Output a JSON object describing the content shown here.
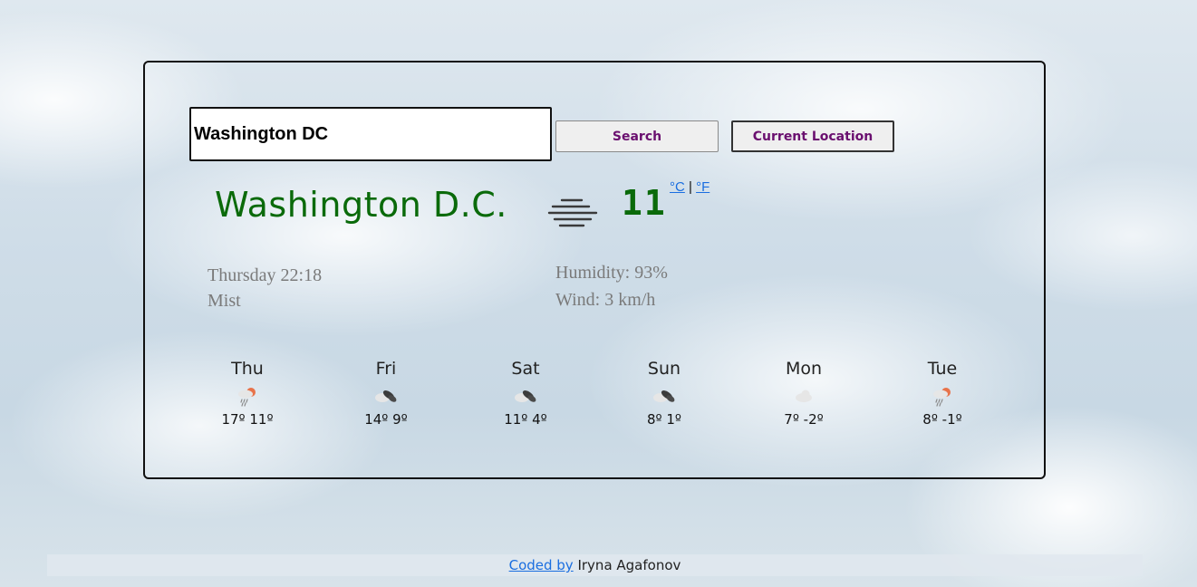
{
  "search": {
    "value": "Washington DC",
    "search_label": "Search",
    "location_label": "Current Location"
  },
  "current": {
    "city": "Washington D.C.",
    "temperature": "11",
    "unit_celsius": "°C",
    "unit_separator": "|",
    "unit_fahrenheit": "°F",
    "date_time": "Thursday 22:18",
    "description": "Mist",
    "humidity": "Humidity: 93%",
    "wind": "Wind: 3 km/h",
    "icon": "mist-icon"
  },
  "forecast": [
    {
      "day": "Thu",
      "temps": "17º 11º",
      "icon": "rain-sun-cloud-icon"
    },
    {
      "day": "Fri",
      "temps": "14º 9º",
      "icon": "broken-clouds-icon"
    },
    {
      "day": "Sat",
      "temps": "11º 4º",
      "icon": "broken-clouds-icon"
    },
    {
      "day": "Sun",
      "temps": "8º 1º",
      "icon": "broken-clouds-icon"
    },
    {
      "day": "Mon",
      "temps": "7º -2º",
      "icon": "cloud-icon"
    },
    {
      "day": "Tue",
      "temps": "8º -1º",
      "icon": "rain-sun-cloud-icon"
    }
  ],
  "footer": {
    "link_text": "Coded by",
    "author": "Iryna Agafonov"
  },
  "colors": {
    "accent_green": "#0a6a0a",
    "button_text": "#6a0f6f",
    "link_blue": "#1a6ee0"
  }
}
